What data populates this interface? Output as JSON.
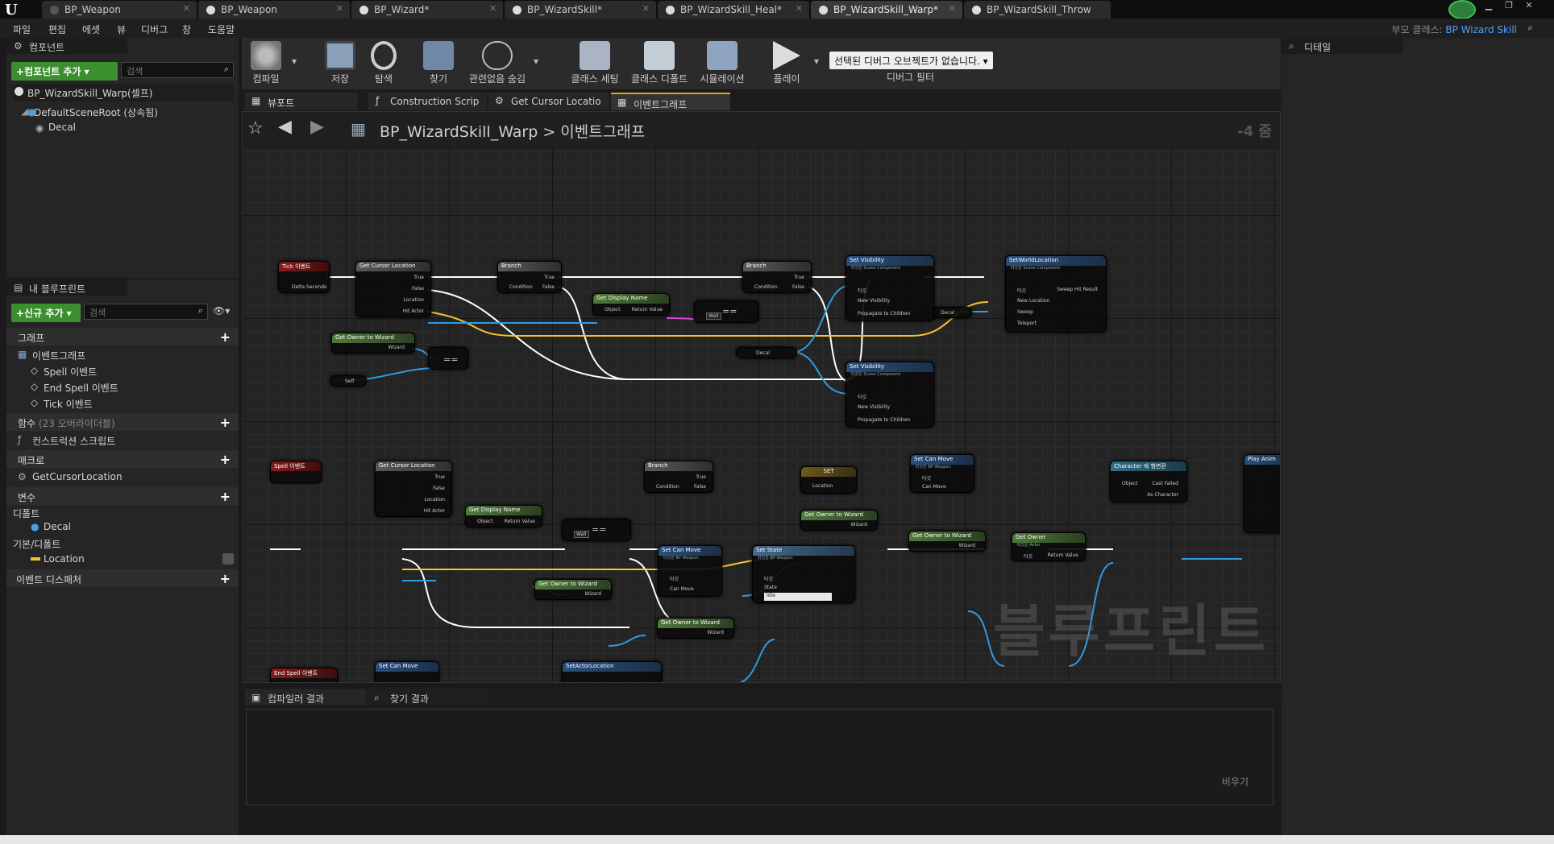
{
  "tabs": [
    {
      "label": "BP_Weapon",
      "active": false
    },
    {
      "label": "BP_Weapon",
      "active": false
    },
    {
      "label": "BP_Wizard*",
      "active": false
    },
    {
      "label": "BP_WizardSkill*",
      "active": false
    },
    {
      "label": "BP_WizardSkill_Heal*",
      "active": false
    },
    {
      "label": "BP_WizardSkill_Warp*",
      "active": true
    },
    {
      "label": "BP_WizardSkill_Throw",
      "active": false
    }
  ],
  "menu": [
    "파일",
    "편집",
    "에셋",
    "뷰",
    "디버그",
    "창",
    "도움말"
  ],
  "parent_class": {
    "prefix": "부모 클래스:",
    "value": "BP Wizard Skill"
  },
  "components_panel": {
    "title": "컴포넌트",
    "add_button": "+컴포넌트 추가 ▾",
    "search_placeholder": "검색",
    "root": "BP_WizardSkill_Warp(셀프)",
    "scene_root": "DefaultSceneRoot (상속됨)",
    "child": "Decal"
  },
  "my_blueprint": {
    "title": "내 블루프린트",
    "add_button": "+신규 추가 ▾",
    "search_placeholder": "검색",
    "graph_section": "그래프",
    "event_graph": "이벤트그래프",
    "events": [
      "Spell 이벤트",
      "End Spell 이벤트",
      "Tick 이벤트"
    ],
    "functions_section": "함수",
    "functions_note": "(23 오버라이더블)",
    "construction_script": "컨스트럭션 스크립트",
    "macros_section": "매크로",
    "macro_item": "GetCursorLocation",
    "variables_section": "변수",
    "components_cat": "디폴트",
    "decal_var": "Decal",
    "basic_cat": "기본/디폴트",
    "location_var": "Location",
    "dispatchers_section": "이벤트 디스패처"
  },
  "toolbar": {
    "buttons": [
      "컴파일",
      "저장",
      "탐색",
      "찾기",
      "관련없음 숨김",
      "클래스 세팅",
      "클래스 디폴트",
      "시뮬레이션",
      "플레이"
    ],
    "debug_select": "선택된 디버그 오브젝트가 없습니다.",
    "debug_label": "디버그 필터"
  },
  "editor_tabs": [
    "뷰포트",
    "Construction Scrip",
    "Get Cursor Locatio",
    "이벤트그래프"
  ],
  "graph": {
    "path_root": "BP_WizardSkill_Warp",
    "path_sep": ">",
    "path_leaf": "이벤트그래프",
    "zoom": "-4 줌",
    "watermark": "블루프린트"
  },
  "nodes": {
    "tick_event": "Tick 이벤트",
    "delta_seconds": "Delta Seconds",
    "get_cursor_location": "Get Cursor Location",
    "true": "True",
    "false": "False",
    "location": "Location",
    "hit_actor": "Hit Actor",
    "branch": "Branch",
    "condition": "Condition",
    "get_display_name": "Get Display Name",
    "object": "Object",
    "return_value": "Return Value",
    "wall": "Wall",
    "eq": "==",
    "get_owner_to_wizard": "Get Owner to Wizard",
    "wizard": "Wizard",
    "self": "Self",
    "set_visibility": "Set Visibility",
    "scene_component": "타깃은 Scene Component",
    "target": "타깃",
    "new_visibility": "New Visibility",
    "propagate": "Propagate to Children",
    "decal": "Decal",
    "set_world_location": "SetWorldLocation",
    "new_location": "New Location",
    "sweep": "Sweep",
    "teleport": "Teleport",
    "sweep_hit": "Sweep Hit Result",
    "spell_event": "Spell 이벤트",
    "set": "SET",
    "set_can_move": "Set Can Move",
    "bp_weapon": "타깃은 BP Weapon",
    "can_move": "Can Move",
    "cast_character": "Character 에 형변환",
    "cast_failed": "Cast Failed",
    "as_character": "As Character",
    "play_anim": "Play Anim",
    "get_owner": "Get Owner",
    "actor": "타깃은 Actor",
    "set_state": "Set State",
    "state": "State",
    "state_value": "Idle",
    "end_spell_event": "End Spell 이벤트",
    "set_actor_location": "SetActorLocation"
  },
  "results_tabs": [
    "컴파일러 결과",
    "찾기 결과"
  ],
  "results_clear": "비우기",
  "details_title": "디테일"
}
